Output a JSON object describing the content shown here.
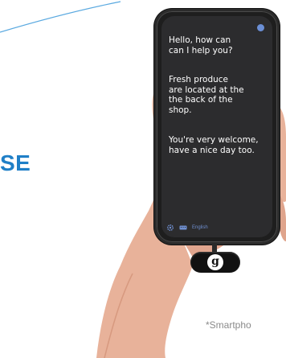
{
  "heading_fragment": "SE",
  "phone": {
    "messages": [
      "Hello, how can\ncan I help you?",
      "Fresh produce\nare located at the\nthe back of the\nshop.",
      "You're very welcome,\nhave a nice day too."
    ],
    "language_label": "English",
    "icons": [
      "gear-icon",
      "keyboard-icon"
    ],
    "status_color": "#6b8fd6"
  },
  "dongle": {
    "logo_letter": "g"
  },
  "footnote": "*Smartpho",
  "colors": {
    "heading": "#1f7fc7",
    "screen_bg": "#2c2c2e",
    "message_text": "#ffffff",
    "accent": "#6f8fd0",
    "footnote": "#8a8a8a"
  }
}
